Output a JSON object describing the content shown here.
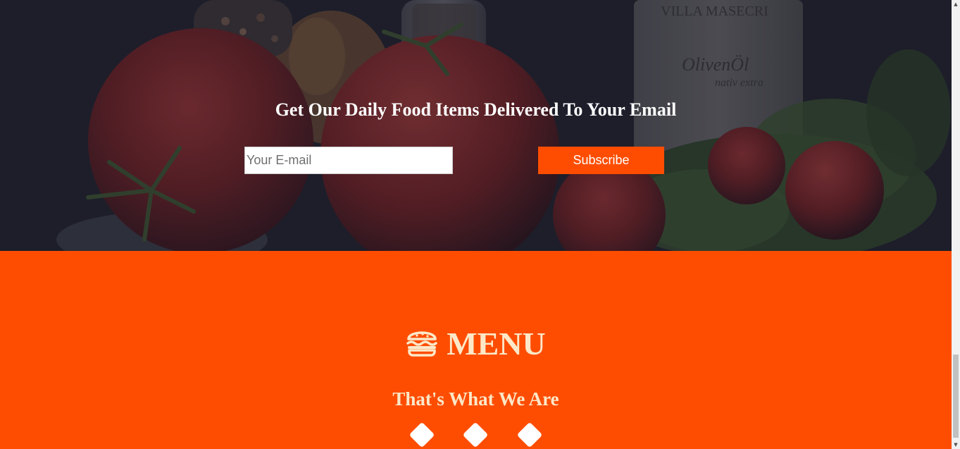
{
  "newsletter": {
    "title": "Get Our Daily Food Items Delivered To Your Email",
    "email_placeholder": "Your E-mail",
    "subscribe_label": "Subscribe",
    "photo_labels": {
      "brand": "VILLA MASECRI",
      "product": "OlivenÖl",
      "variant": "nativ extra"
    }
  },
  "menu": {
    "title": "MENU",
    "subtitle": "That's What We Are",
    "icon": "hamburger-icon",
    "decorations": [
      "diamond",
      "diamond",
      "diamond"
    ]
  },
  "colors": {
    "accent": "#fe4d00",
    "hero_bg": "#1e2028",
    "cream_text": "#fce8c8",
    "white": "#ffffff"
  },
  "scrollbar": {
    "up_arrow": "▲",
    "down_arrow": "▼"
  }
}
